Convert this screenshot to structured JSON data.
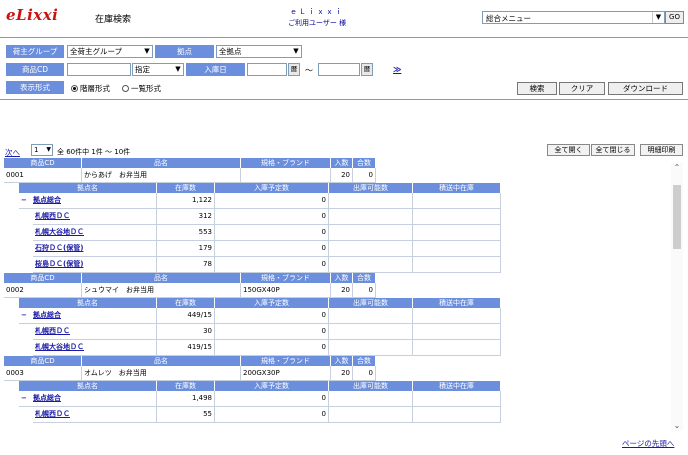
{
  "header": {
    "logo": "eLixxi",
    "page_title": "在庫検索",
    "user_line1": "ｅＬｉｘｘｉ",
    "user_line2": "ご利用ユーザー 様",
    "menu_value": "総合メニュー",
    "go_label": "GO"
  },
  "search": {
    "group_label": "荷主グループ",
    "group_value": "全荷主グループ",
    "base_label": "拠点",
    "base_value": "全拠点",
    "item_label": "商品CD",
    "spec_value": "指定",
    "date_label": "入庫日",
    "calendar_label": "暦",
    "range_sep": "～",
    "more_link": "≫",
    "display_label": "表示形式",
    "radio_tree": "階層形式",
    "radio_list": "一覧形式",
    "search_btn": "検索",
    "clear_btn": "クリア",
    "download_btn": "ダウンロード"
  },
  "pager": {
    "next_link": "次へ",
    "page_value": "1",
    "info": "全 60件中 1件 ～ 10件",
    "open_all": "全て開く",
    "close_all": "全て閉じる",
    "print": "明細印刷"
  },
  "product_headers": [
    "商品CD",
    "品名",
    "規格・ブランド",
    "入数",
    "合数"
  ],
  "base_headers": [
    "拠点名",
    "在庫数",
    "入庫予定数",
    "出庫可能数",
    "積送中在庫"
  ],
  "products": [
    {
      "code": "0001",
      "name": "からあげ　お弁当用",
      "spec": "",
      "qty": "20",
      "count": "0",
      "rows": [
        {
          "name": "拠点総合",
          "stock": "1,122",
          "inbound": "0",
          "avail": "",
          "transit": "",
          "total": true
        },
        {
          "name": "札幌西ＤＣ",
          "stock": "312",
          "inbound": "0",
          "avail": "",
          "transit": ""
        },
        {
          "name": "札幌大谷地ＤＣ",
          "stock": "553",
          "inbound": "0",
          "avail": "",
          "transit": ""
        },
        {
          "name": "石狩ＤＣ(保管)",
          "stock": "179",
          "inbound": "0",
          "avail": "",
          "transit": ""
        },
        {
          "name": "桜島ＤＣ(保管)",
          "stock": "78",
          "inbound": "0",
          "avail": "",
          "transit": ""
        }
      ]
    },
    {
      "code": "0002",
      "name": "シュウマイ　お弁当用",
      "spec": "150GX40P",
      "qty": "20",
      "count": "0",
      "rows": [
        {
          "name": "拠点総合",
          "stock": "449/15",
          "inbound": "0",
          "avail": "",
          "transit": "",
          "total": true
        },
        {
          "name": "札幌西ＤＣ",
          "stock": "30",
          "inbound": "0",
          "avail": "",
          "transit": ""
        },
        {
          "name": "札幌大谷地ＤＣ",
          "stock": "419/15",
          "inbound": "0",
          "avail": "",
          "transit": ""
        }
      ]
    },
    {
      "code": "0003",
      "name": "オムレツ　お弁当用",
      "spec": "200GX30P",
      "qty": "20",
      "count": "0",
      "rows": [
        {
          "name": "拠点総合",
          "stock": "1,498",
          "inbound": "0",
          "avail": "",
          "transit": "",
          "total": true
        },
        {
          "name": "札幌西ＤＣ",
          "stock": "55",
          "inbound": "0",
          "avail": "",
          "transit": ""
        }
      ]
    }
  ],
  "footer": {
    "top_link": "ページの先頭へ"
  },
  "colors": {
    "header_blue": "#6b8fdc",
    "logo_red": "#cc1111",
    "link_blue": "#1a1aa6"
  }
}
